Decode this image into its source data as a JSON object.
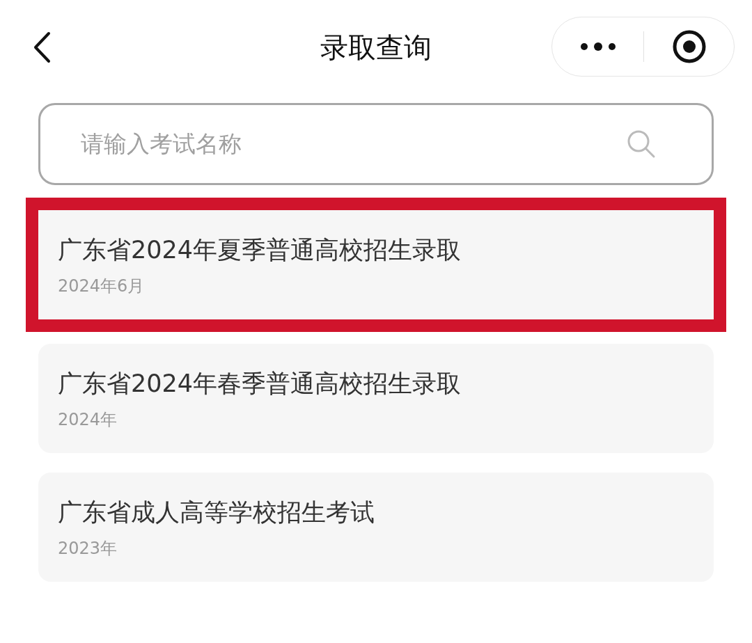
{
  "header": {
    "title": "录取查询"
  },
  "search": {
    "placeholder": "请输入考试名称"
  },
  "exams": [
    {
      "title": "广东省2024年夏季普通高校招生录取",
      "date": "2024年6月",
      "highlighted": true
    },
    {
      "title": "广东省2024年春季普通高校招生录取",
      "date": "2024年",
      "highlighted": false
    },
    {
      "title": "广东省成人高等学校招生考试",
      "date": "2023年",
      "highlighted": false
    }
  ]
}
